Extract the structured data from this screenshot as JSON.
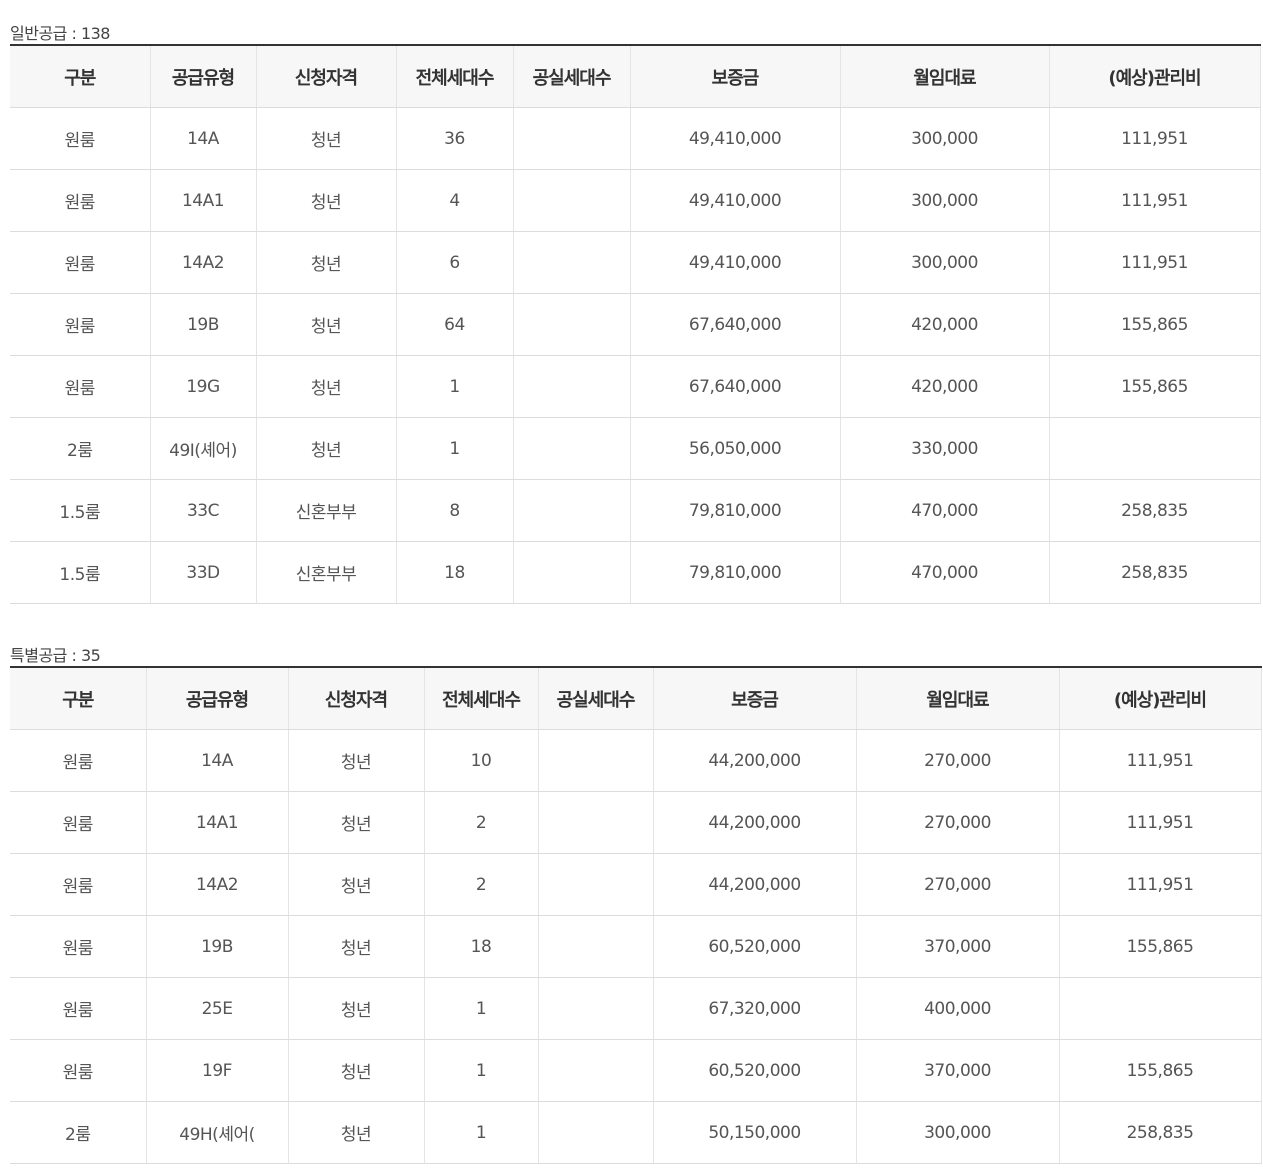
{
  "general": {
    "title": "일반공급 : 138",
    "headers": [
      "구분",
      "공급유형",
      "신청자격",
      "전체세대수",
      "공실세대수",
      "보증금",
      "월임대료",
      "(예상)관리비"
    ],
    "rows": [
      [
        "원룸",
        "14A",
        "청년",
        "36",
        "",
        "49,410,000",
        "300,000",
        "111,951"
      ],
      [
        "원룸",
        "14A1",
        "청년",
        "4",
        "",
        "49,410,000",
        "300,000",
        "111,951"
      ],
      [
        "원룸",
        "14A2",
        "청년",
        "6",
        "",
        "49,410,000",
        "300,000",
        "111,951"
      ],
      [
        "원룸",
        "19B",
        "청년",
        "64",
        "",
        "67,640,000",
        "420,000",
        "155,865"
      ],
      [
        "원룸",
        "19G",
        "청년",
        "1",
        "",
        "67,640,000",
        "420,000",
        "155,865"
      ],
      [
        "2룸",
        "49I(셰어)",
        "청년",
        "1",
        "",
        "56,050,000",
        "330,000",
        ""
      ],
      [
        "1.5룸",
        "33C",
        "신혼부부",
        "8",
        "",
        "79,810,000",
        "470,000",
        "258,835"
      ],
      [
        "1.5룸",
        "33D",
        "신혼부부",
        "18",
        "",
        "79,810,000",
        "470,000",
        "258,835"
      ]
    ]
  },
  "special": {
    "title": "특별공급 : 35",
    "headers": [
      "구분",
      "공급유형",
      "신청자격",
      "전체세대수",
      "공실세대수",
      "보증금",
      "월임대료",
      "(예상)관리비"
    ],
    "rows": [
      [
        "원룸",
        "14A",
        "청년",
        "10",
        "",
        "44,200,000",
        "270,000",
        "111,951"
      ],
      [
        "원룸",
        "14A1",
        "청년",
        "2",
        "",
        "44,200,000",
        "270,000",
        "111,951"
      ],
      [
        "원룸",
        "14A2",
        "청년",
        "2",
        "",
        "44,200,000",
        "270,000",
        "111,951"
      ],
      [
        "원룸",
        "19B",
        "청년",
        "18",
        "",
        "60,520,000",
        "370,000",
        "155,865"
      ],
      [
        "원룸",
        "25E",
        "청년",
        "1",
        "",
        "67,320,000",
        "400,000",
        ""
      ],
      [
        "원룸",
        "19F",
        "청년",
        "1",
        "",
        "60,520,000",
        "370,000",
        "155,865"
      ],
      [
        "2룸",
        "49H(셰어(",
        "청년",
        "1",
        "",
        "50,150,000",
        "300,000",
        "258,835"
      ]
    ]
  }
}
